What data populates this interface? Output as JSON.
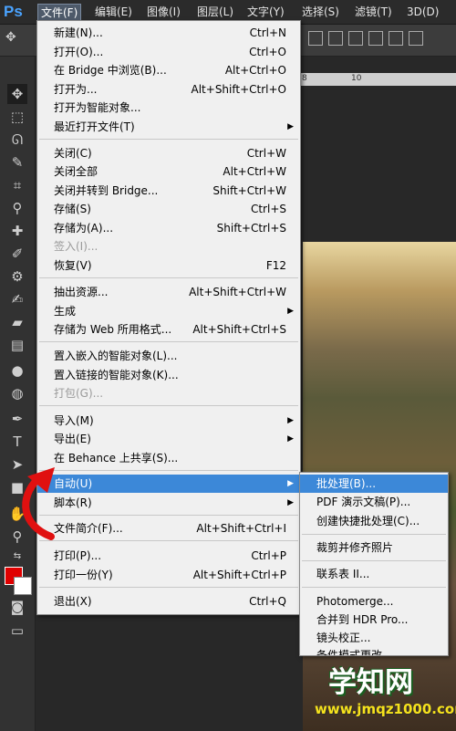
{
  "app": {
    "logo": "Ps"
  },
  "menubar": [
    {
      "label": "文件(F)",
      "active": true
    },
    {
      "label": "编辑(E)"
    },
    {
      "label": "图像(I)"
    },
    {
      "label": "图层(L)"
    },
    {
      "label": "文字(Y)"
    },
    {
      "label": "选择(S)"
    },
    {
      "label": "滤镜(T)"
    },
    {
      "label": "3D(D)"
    }
  ],
  "ruler": {
    "n1": "8",
    "n2": "10"
  },
  "file_menu": {
    "items": [
      {
        "label": "新建(N)...",
        "shortcut": "Ctrl+N"
      },
      {
        "label": "打开(O)...",
        "shortcut": "Ctrl+O"
      },
      {
        "label": "在 Bridge 中浏览(B)...",
        "shortcut": "Alt+Ctrl+O"
      },
      {
        "label": "打开为...",
        "shortcut": "Alt+Shift+Ctrl+O"
      },
      {
        "label": "打开为智能对象..."
      },
      {
        "label": "最近打开文件(T)"
      },
      {
        "label": "关闭(C)",
        "shortcut": "Ctrl+W"
      },
      {
        "label": "关闭全部",
        "shortcut": "Alt+Ctrl+W"
      },
      {
        "label": "关闭并转到 Bridge...",
        "shortcut": "Shift+Ctrl+W"
      },
      {
        "label": "存储(S)",
        "shortcut": "Ctrl+S"
      },
      {
        "label": "存储为(A)...",
        "shortcut": "Shift+Ctrl+S"
      },
      {
        "label": "签入(I)..."
      },
      {
        "label": "恢复(V)",
        "shortcut": "F12"
      },
      {
        "label": "抽出资源...",
        "shortcut": "Alt+Shift+Ctrl+W"
      },
      {
        "label": "生成"
      },
      {
        "label": "存储为 Web 所用格式...",
        "shortcut": "Alt+Shift+Ctrl+S"
      },
      {
        "label": "置入嵌入的智能对象(L)..."
      },
      {
        "label": "置入链接的智能对象(K)..."
      },
      {
        "label": "打包(G)..."
      },
      {
        "label": "导入(M)"
      },
      {
        "label": "导出(E)"
      },
      {
        "label": "在 Behance 上共享(S)..."
      },
      {
        "label": "自动(U)"
      },
      {
        "label": "脚本(R)"
      },
      {
        "label": "文件简介(F)...",
        "shortcut": "Alt+Shift+Ctrl+I"
      },
      {
        "label": "打印(P)...",
        "shortcut": "Ctrl+P"
      },
      {
        "label": "打印一份(Y)",
        "shortcut": "Alt+Shift+Ctrl+P"
      },
      {
        "label": "退出(X)",
        "shortcut": "Ctrl+Q"
      }
    ]
  },
  "automate_submenu": {
    "items": [
      {
        "label": "批处理(B)..."
      },
      {
        "label": "PDF 演示文稿(P)..."
      },
      {
        "label": "创建快捷批处理(C)..."
      },
      {
        "label": "裁剪并修齐照片"
      },
      {
        "label": "联系表 II..."
      },
      {
        "label": "Photomerge..."
      },
      {
        "label": "合并到 HDR Pro..."
      },
      {
        "label": "镜头校正..."
      },
      {
        "label": "条件模式更改..."
      }
    ]
  },
  "watermark": {
    "title": "学知网",
    "url": "www.jmqz1000.com"
  },
  "colors": {
    "highlight": "#3c88d8",
    "foreground": "#e00000",
    "background": "#ffffff"
  }
}
